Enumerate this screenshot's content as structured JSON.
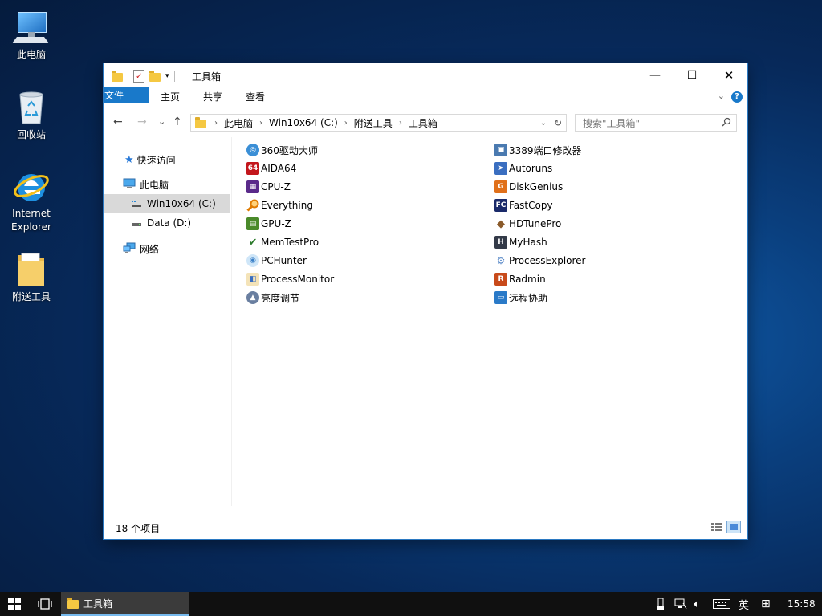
{
  "desktop": {
    "icons": [
      {
        "label": "此电脑",
        "icon": "computer-icon"
      },
      {
        "label": "回收站",
        "icon": "recycle-bin-icon"
      },
      {
        "label": "Internet Explorer",
        "icon": "ie-icon"
      },
      {
        "label": "附送工具",
        "icon": "folder-icon"
      }
    ]
  },
  "window": {
    "title": "工具箱",
    "controls": {
      "minimize": "—",
      "maximize": "☐",
      "close": "✕"
    },
    "ribbon_tabs": [
      "文件",
      "主页",
      "共享",
      "查看"
    ],
    "help": "?",
    "nav_buttons": {
      "back": "←",
      "forward": "→",
      "recent": "⌄",
      "up": "↑"
    },
    "breadcrumb": [
      "此电脑",
      "Win10x64 (C:)",
      "附送工具",
      "工具箱"
    ],
    "refresh": "↻",
    "search_placeholder": "搜索\"工具箱\"",
    "nav_pane": [
      {
        "label": "快速访问",
        "icon": "star-icon",
        "selected": false
      },
      {
        "label": "此电脑",
        "icon": "computer-icon",
        "selected": false
      },
      {
        "label": "Win10x64 (C:)",
        "icon": "drive-icon",
        "selected": true
      },
      {
        "label": "Data (D:)",
        "icon": "drive-icon",
        "selected": false
      },
      {
        "label": "网络",
        "icon": "network-icon",
        "selected": false
      }
    ],
    "files_left": [
      {
        "name": "360驱动大师",
        "icon": "360-driver-icon",
        "color": "#3b8fd6"
      },
      {
        "name": "AIDA64",
        "icon": "aida64-icon",
        "color": "#c3161c"
      },
      {
        "name": "CPU-Z",
        "icon": "cpuz-icon",
        "color": "#5a2a8a"
      },
      {
        "name": "Everything",
        "icon": "magnifier-icon",
        "color": "#e07b00"
      },
      {
        "name": "GPU-Z",
        "icon": "gpuz-icon",
        "color": "#4a8a2a"
      },
      {
        "name": "MemTestPro",
        "icon": "memtest-icon",
        "color": "#2b7a2b"
      },
      {
        "name": "PCHunter",
        "icon": "pchunter-icon",
        "color": "#5aa0d8"
      },
      {
        "name": "ProcessMonitor",
        "icon": "procmon-icon",
        "color": "#d08a20"
      },
      {
        "name": "亮度调节",
        "icon": "brightness-icon",
        "color": "#6a7fa0"
      }
    ],
    "files_right": [
      {
        "name": "3389端口修改器",
        "icon": "rdp-port-icon",
        "color": "#4a7ab0"
      },
      {
        "name": "Autoruns",
        "icon": "autoruns-icon",
        "color": "#3a6ec0"
      },
      {
        "name": "DiskGenius",
        "icon": "diskgenius-icon",
        "color": "#e0701a"
      },
      {
        "name": "FastCopy",
        "icon": "fastcopy-icon",
        "color": "#1a2a6a"
      },
      {
        "name": "HDTunePro",
        "icon": "hdtune-icon",
        "color": "#8a5a2a"
      },
      {
        "name": "MyHash",
        "icon": "myhash-icon",
        "color": "#333a48"
      },
      {
        "name": "ProcessExplorer",
        "icon": "procexp-icon",
        "color": "#5a8ac8"
      },
      {
        "name": "Radmin",
        "icon": "radmin-icon",
        "color": "#c84a1a"
      },
      {
        "name": "远程协助",
        "icon": "remote-assist-icon",
        "color": "#2a7ac8"
      }
    ],
    "status_text": "18 个项目"
  },
  "taskbar": {
    "app_label": "工具箱",
    "ime": "英",
    "time": "15:58"
  }
}
